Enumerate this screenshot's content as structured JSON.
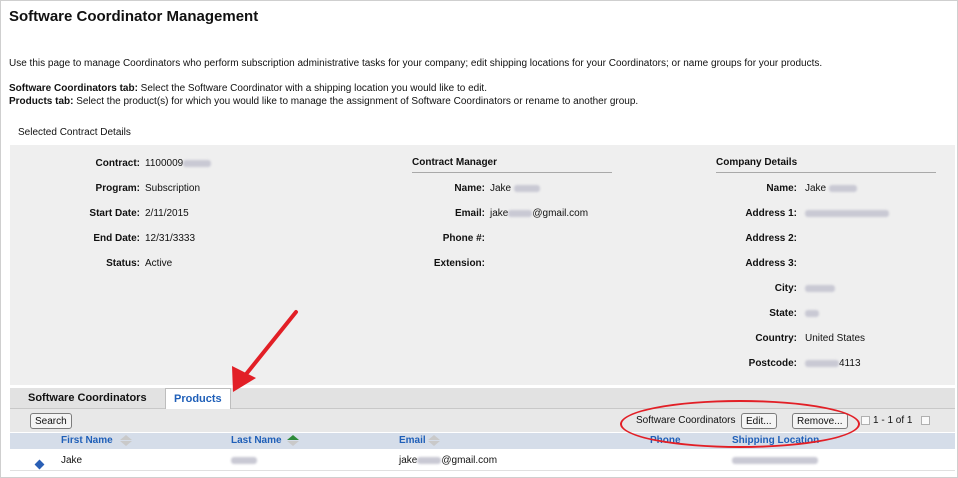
{
  "page": {
    "title": "Software Coordinator Management",
    "intro": "Use this page to manage Coordinators who perform subscription administrative tasks for your company; edit shipping locations for your Coordinators; or name groups for your products.",
    "help_sc_label": "Software Coordinators tab:",
    "help_sc_text": " Select the Software Coordinator with a shipping location you would like to edit.",
    "help_products_label": "Products tab:",
    "help_products_text": " Select the product(s) for which you would like to manage the assignment of Software Coordinators or rename to another group.",
    "section_label": "Selected Contract Details"
  },
  "contract": {
    "contract_label": "Contract:",
    "contract_value": "1100009",
    "program_label": "Program:",
    "program_value": "Subscription",
    "start_label": "Start Date:",
    "start_value": "2/11/2015",
    "end_label": "End Date:",
    "end_value": "12/31/3333",
    "status_label": "Status:",
    "status_value": "Active"
  },
  "manager": {
    "heading": "Contract Manager",
    "name_label": "Name:",
    "name_value": "Jake",
    "email_label": "Email:",
    "email_prefix": "jake",
    "email_suffix": "@gmail.com",
    "phone_label": "Phone #:",
    "extension_label": "Extension:"
  },
  "company": {
    "heading": "Company Details",
    "name_label": "Name:",
    "name_value": "Jake",
    "address1_label": "Address 1:",
    "address2_label": "Address 2:",
    "address3_label": "Address 3:",
    "city_label": "City:",
    "state_label": "State:",
    "country_label": "Country:",
    "country_value": "United States",
    "postcode_label": "Postcode:",
    "postcode_suffix": "4113"
  },
  "tabs": {
    "software_coordinators": "Software Coordinators",
    "products": "Products"
  },
  "toolbar": {
    "search_label": "Search",
    "sc_label": "Software Coordinators",
    "edit_label": "Edit...",
    "remove_label": "Remove...",
    "pager_text": "1 - 1 of 1"
  },
  "grid": {
    "columns": [
      "First Name",
      "Last Name",
      "Email",
      "Phone",
      "Shipping Location"
    ],
    "rows": [
      {
        "first_name": "Jake",
        "email_prefix": "jake",
        "email_suffix": "@gmail.com"
      }
    ]
  },
  "colors": {
    "annotation_red": "#e21f26",
    "link_blue": "#1f5fb8",
    "sort_green": "#2e8b3a"
  }
}
